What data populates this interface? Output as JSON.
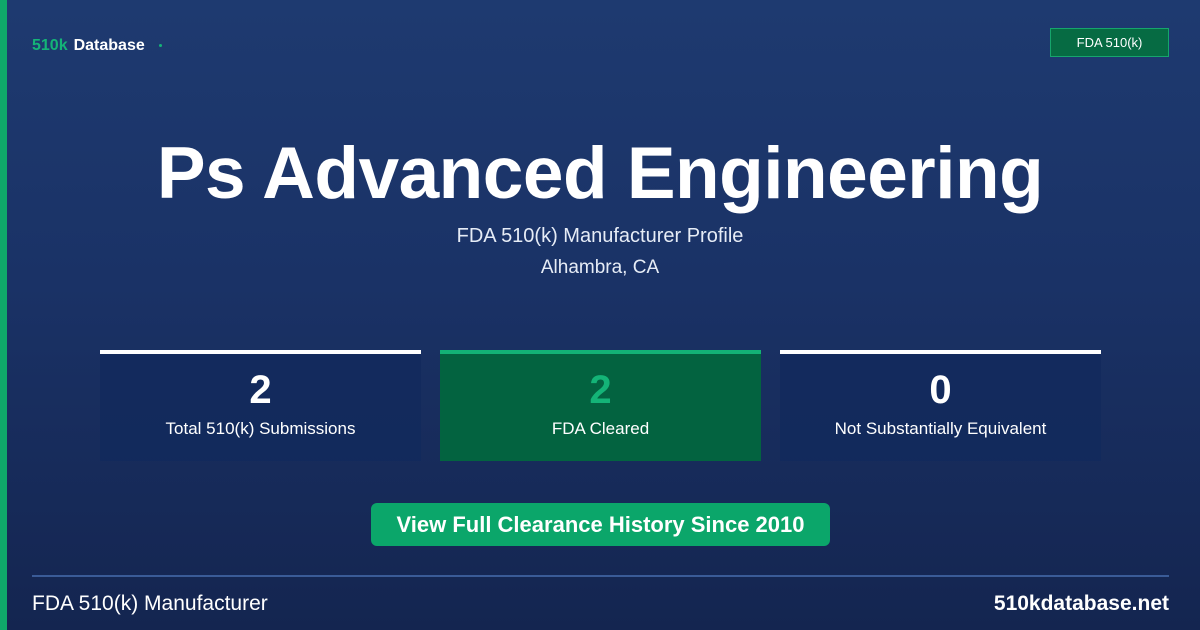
{
  "header": {
    "brand_accent": "510k",
    "brand_main": "Database",
    "badge": "FDA 510(k)"
  },
  "hero": {
    "title": "Ps Advanced Engineering",
    "subtitle": "FDA 510(k) Manufacturer Profile",
    "location": "Alhambra, CA"
  },
  "stats": [
    {
      "value": "2",
      "label": "Total 510(k) Submissions"
    },
    {
      "value": "2",
      "label": "FDA Cleared"
    },
    {
      "value": "0",
      "label": "Not Substantially Equivalent"
    }
  ],
  "cta": {
    "label": "View Full Clearance History Since 2010"
  },
  "footer": {
    "left": "FDA 510(k) Manufacturer",
    "right": "510kdatabase.net"
  },
  "colors": {
    "background_top": "#1e3a70",
    "background_bottom": "#142550",
    "accent_green": "#14b477",
    "button_green": "#0ba66a",
    "card_green": "#036340"
  }
}
